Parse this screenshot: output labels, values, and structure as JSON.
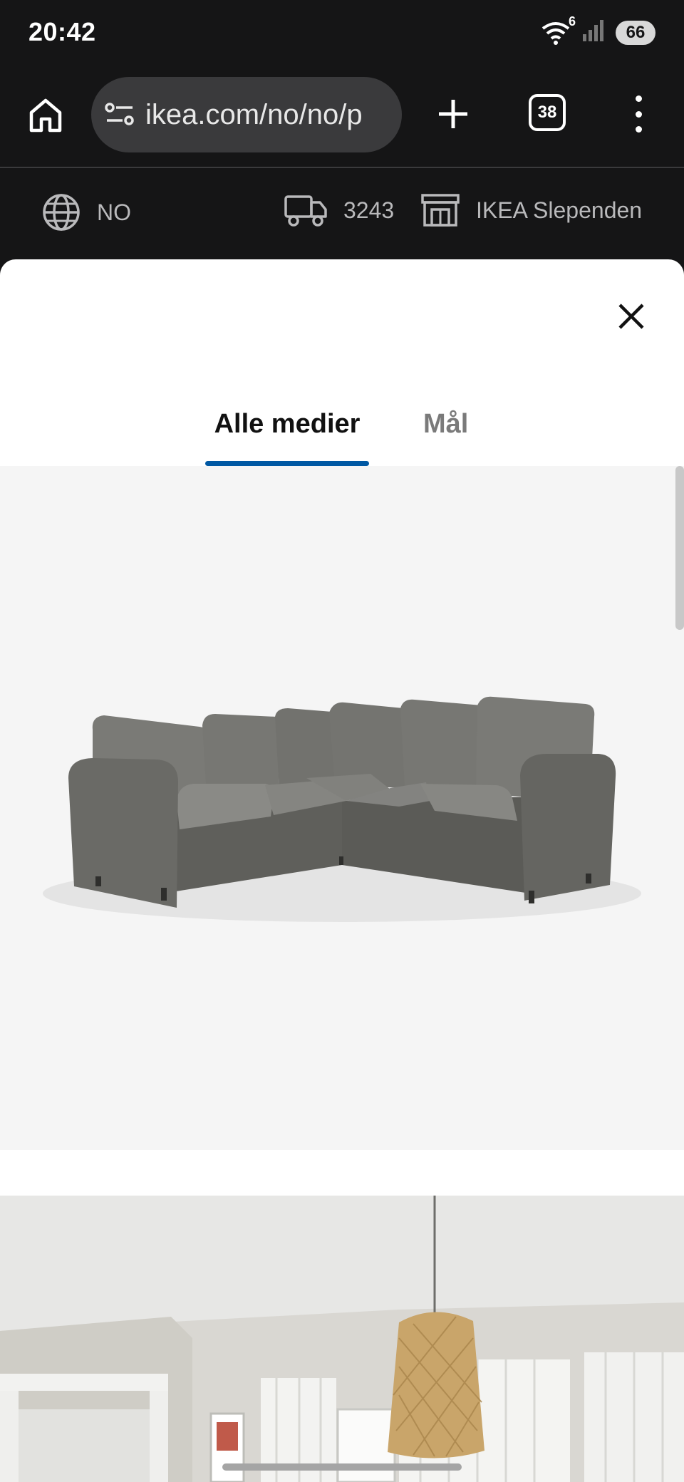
{
  "status_bar": {
    "time": "20:42",
    "wifi_label": "6",
    "battery": "66"
  },
  "browser": {
    "url": "ikea.com/no/no/p",
    "tab_count": "38"
  },
  "top_strip": {
    "country": "NO",
    "postcode": "3243",
    "store": "IKEA Slependen"
  },
  "modal": {
    "tabs": [
      {
        "label": "Alle medier",
        "selected": true
      },
      {
        "label": "Mål",
        "selected": false
      }
    ]
  },
  "colors": {
    "accent": "#0058a3",
    "dark_bg": "#151516",
    "sofa": "#6b6b67"
  },
  "icons": [
    "home-icon",
    "site-settings-icon",
    "plus-icon",
    "more-vertical-icon",
    "globe-icon",
    "truck-icon",
    "store-icon",
    "close-icon",
    "wifi-icon",
    "signal-icon"
  ]
}
